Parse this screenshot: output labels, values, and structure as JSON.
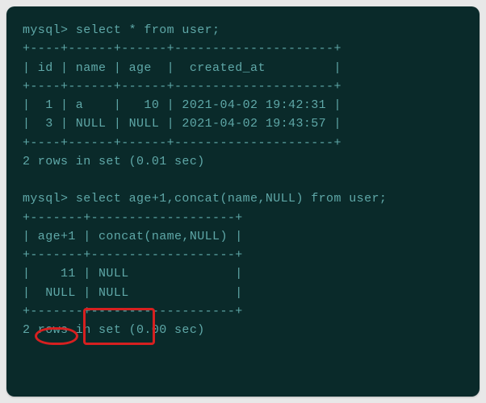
{
  "query1": {
    "prompt": "mysql> ",
    "sql": "select * from user;",
    "separator_top": "+----+------+------+---------------------+",
    "header": "| id | name | age  |  created_at         |",
    "separator_mid": "+----+------+------+---------------------+",
    "rows": [
      "|  1 | a    |   10 | 2021-04-02 19:42:31 |",
      "|  3 | NULL | NULL | 2021-04-02 19:43:57 |"
    ],
    "separator_bot": "+----+------+------+---------------------+",
    "summary": "2 rows in set (0.01 sec)"
  },
  "query2": {
    "prompt": "mysql> ",
    "sql": "select age+1,concat(name,NULL) from user;",
    "separator_top": "+-------+-------------------+",
    "header": "| age+1 | concat(name,NULL) |",
    "separator_mid": "+-------+-------------------+",
    "rows": [
      "|    11 | NULL              |",
      "|  NULL | NULL              |"
    ],
    "separator_bot": "+-------+-------------------+",
    "summary": "2 rows in set (0.00 sec)"
  }
}
